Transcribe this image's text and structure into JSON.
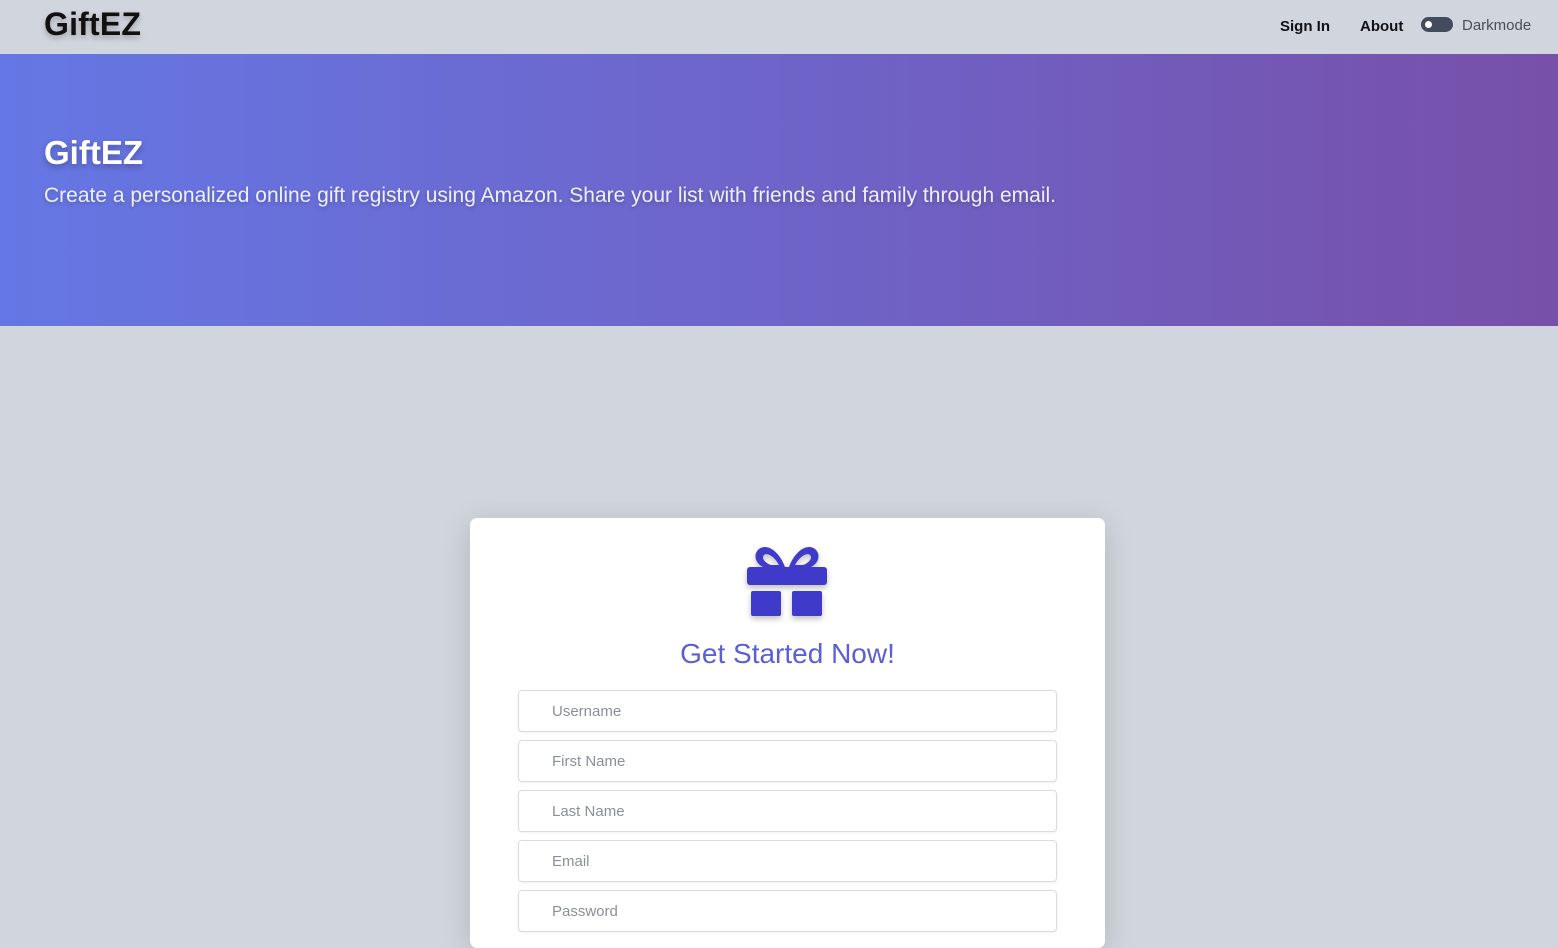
{
  "navbar": {
    "brand": "GiftEZ",
    "links": {
      "sign_in": "Sign In",
      "about": "About"
    },
    "darkmode": {
      "label": "Darkmode",
      "enabled": false
    }
  },
  "hero": {
    "title": "GiftEZ",
    "subtitle": "Create a personalized online gift registry using Amazon. Share your list with friends and family through email."
  },
  "signup_card": {
    "icon": "gift-icon",
    "title": "Get Started Now!",
    "fields": {
      "username": {
        "placeholder": "Username",
        "value": ""
      },
      "first_name": {
        "placeholder": "First Name",
        "value": ""
      },
      "last_name": {
        "placeholder": "Last Name",
        "value": ""
      },
      "email": {
        "placeholder": "Email",
        "value": ""
      },
      "password": {
        "placeholder": "Password",
        "value": ""
      }
    }
  },
  "colors": {
    "accent": "#5b5fd6",
    "icon": "#3f3ac9",
    "hero_gradient_start": "#6577e4",
    "hero_gradient_end": "#7750a9",
    "background": "#d1d5dd"
  }
}
